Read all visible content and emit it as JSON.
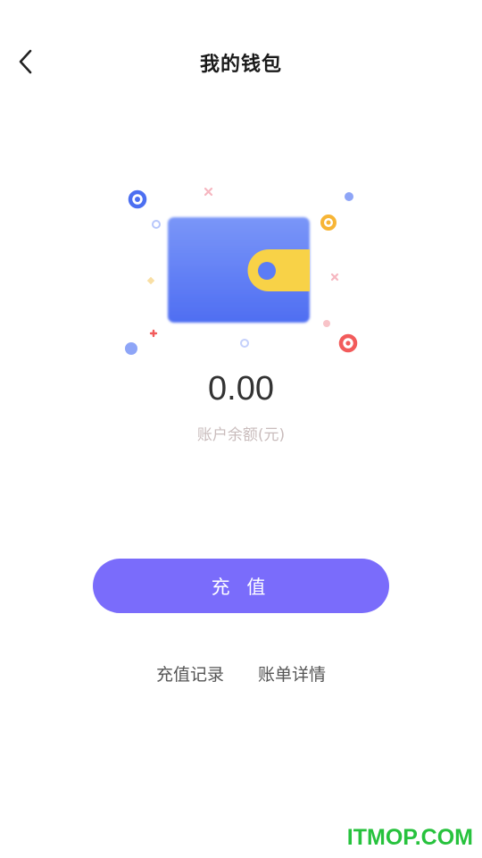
{
  "header": {
    "title": "我的钱包",
    "back_icon": "chevron-left-icon"
  },
  "wallet": {
    "illustration_icon": "wallet-illustration",
    "balance": "0.00",
    "balance_label": "账户余额(元)"
  },
  "actions": {
    "recharge_label": "充 值",
    "recharge_records_label": "充值记录",
    "bill_details_label": "账单详情"
  },
  "watermark": {
    "text": "ITMOP.COM"
  },
  "colors": {
    "accent": "#7a6cfb",
    "wallet_blue": "#5b7cf5",
    "wallet_clasp": "#f8d247",
    "watermark": "#27c23d"
  }
}
